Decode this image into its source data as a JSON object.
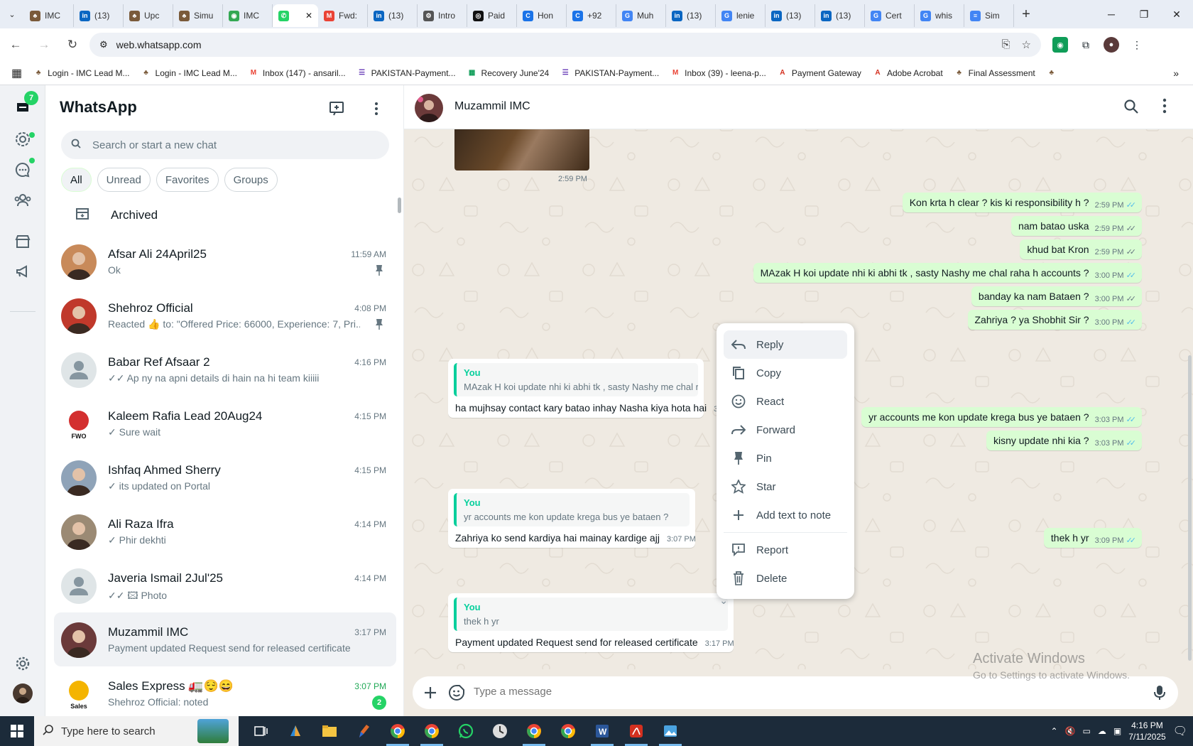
{
  "browser": {
    "tabs": [
      {
        "label": "IMC",
        "icon": "imc-icon",
        "color": "#7a5a3a"
      },
      {
        "label": "(13)",
        "icon": "linkedin-icon",
        "color": "#0a66c2"
      },
      {
        "label": "Upc",
        "icon": "imc-icon",
        "color": "#7a5a3a"
      },
      {
        "label": "Simu",
        "icon": "imc-icon",
        "color": "#7a5a3a"
      },
      {
        "label": "IMC",
        "icon": "maps-icon",
        "color": "#34a853"
      },
      {
        "label": "",
        "icon": "whatsapp-icon",
        "color": "#25d366",
        "active": true
      },
      {
        "label": "Fwd:",
        "icon": "gmail-icon",
        "color": "#ea4335"
      },
      {
        "label": "(13)",
        "icon": "linkedin-icon",
        "color": "#0a66c2"
      },
      {
        "label": "Intro",
        "icon": "gear-icon",
        "color": "#555555"
      },
      {
        "label": "Paid",
        "icon": "openai-icon",
        "color": "#111111"
      },
      {
        "label": "Hon",
        "icon": "copilot-icon",
        "color": "#1a73e8"
      },
      {
        "label": "+92",
        "icon": "copilot-icon",
        "color": "#1a73e8"
      },
      {
        "label": "Muh",
        "icon": "google-icon",
        "color": "#4285f4"
      },
      {
        "label": "(13)",
        "icon": "linkedin-icon",
        "color": "#0a66c2"
      },
      {
        "label": "lenie",
        "icon": "google-icon",
        "color": "#4285f4"
      },
      {
        "label": "(13)",
        "icon": "linkedin-icon",
        "color": "#0a66c2"
      },
      {
        "label": "(13)",
        "icon": "linkedin-icon",
        "color": "#0a66c2"
      },
      {
        "label": "Cert",
        "icon": "google-icon",
        "color": "#4285f4"
      },
      {
        "label": "whis",
        "icon": "google-icon",
        "color": "#4285f4"
      },
      {
        "label": "Sim",
        "icon": "docs-icon",
        "color": "#4285f4"
      }
    ],
    "url": "web.whatsapp.com",
    "bookmarks": [
      {
        "label": "Login - IMC Lead M...",
        "icon": "imc-icon",
        "color": "#7a5a3a"
      },
      {
        "label": "Login - IMC Lead M...",
        "icon": "imc-icon",
        "color": "#7a5a3a"
      },
      {
        "label": "Inbox (147) - ansaril...",
        "icon": "gmail-icon",
        "color": "#ea4335"
      },
      {
        "label": "PAKISTAN-Payment...",
        "icon": "forms-icon",
        "color": "#673ab7"
      },
      {
        "label": "Recovery June'24",
        "icon": "sheets-icon",
        "color": "#0f9d58"
      },
      {
        "label": "PAKISTAN-Payment...",
        "icon": "forms-icon",
        "color": "#673ab7"
      },
      {
        "label": "Inbox (39) - leena-p...",
        "icon": "gmail-icon",
        "color": "#ea4335"
      },
      {
        "label": "Payment Gateway",
        "icon": "acrobat-icon",
        "color": "#d4301f"
      },
      {
        "label": "Adobe Acrobat",
        "icon": "acrobat-icon",
        "color": "#d4301f"
      },
      {
        "label": "Final Assessment",
        "icon": "imc-icon",
        "color": "#7a5a3a"
      },
      {
        "label": "",
        "icon": "imc-icon",
        "color": "#7a5a3a"
      }
    ]
  },
  "rail": {
    "chats_badge": "7"
  },
  "sidebar": {
    "title": "WhatsApp",
    "search_placeholder": "Search or start a new chat",
    "filters": [
      "All",
      "Unread",
      "Favorites",
      "Groups"
    ],
    "archived_label": "Archived",
    "chats": [
      {
        "name": "Afsar Ali 24April25",
        "time": "11:59 AM",
        "message": "Ok",
        "pinned": true,
        "avatar": "photo",
        "avatar_color": "#c88a5a"
      },
      {
        "name": "Shehroz Official",
        "time": "4:08 PM",
        "message": "Reacted 👍 to: \"Offered Price: 66000, Experience: 7, Pri...",
        "pinned": true,
        "avatar": "photo",
        "avatar_color": "#c0392b"
      },
      {
        "name": "Babar Ref Afsaar 2",
        "time": "4:16 PM",
        "message": "✓✓ Ap ny na apni details di hain na hi team kiiiii",
        "avatar": "default"
      },
      {
        "name": "Kaleem Rafia Lead 20Aug24",
        "time": "4:15 PM",
        "message": "✓ Sure wait",
        "avatar": "logo",
        "avatar_color": "#d32f2f",
        "avatar_text": "FWO"
      },
      {
        "name": "Ishfaq Ahmed Sherry",
        "time": "4:15 PM",
        "message": "✓ its updated on Portal",
        "avatar": "photo",
        "avatar_color": "#8fa3b8"
      },
      {
        "name": "Ali Raza Ifra",
        "time": "4:14 PM",
        "message": "✓ Phir dekhti",
        "avatar": "photo",
        "avatar_color": "#9b8a74"
      },
      {
        "name": "Javeria Ismail 2Jul'25",
        "time": "4:14 PM",
        "message": "✓✓ 🖾 Photo",
        "avatar": "default"
      },
      {
        "name": "Muzammil IMC",
        "time": "3:17 PM",
        "message": "Payment updated Request send for released certificate",
        "avatar": "photo",
        "avatar_color": "#6b3a3a",
        "selected": true
      },
      {
        "name": "Sales Express 🚛😌😄",
        "time": "3:07 PM",
        "message": "Shehroz Official: noted",
        "avatar": "logo",
        "avatar_color": "#f4b400",
        "avatar_text": "Sales",
        "unread": "2"
      }
    ]
  },
  "conversation": {
    "contact_name": "Muzammil IMC",
    "image_time": "2:59 PM",
    "outgoing": [
      {
        "text": "Kon krta h clear ? kis ki responsibility h ?",
        "time": "2:59 PM",
        "read": true
      },
      {
        "text": "nam batao uska",
        "time": "2:59 PM",
        "read": false
      },
      {
        "text": "khud bat Kron",
        "time": "2:59 PM",
        "read": false
      },
      {
        "text": "MAzak H koi update nhi ki abhi tk , sasty Nashy me chal raha h accounts ?",
        "time": "3:00 PM",
        "read": true
      },
      {
        "text": "banday ka nam Bataen ?",
        "time": "3:00 PM",
        "read": false
      },
      {
        "text": "Zahriya ? ya Shobhit Sir ?",
        "time": "3:00 PM",
        "read": true
      },
      {
        "text": "yr accounts me kon update krega bus ye bataen ?",
        "time": "3:03 PM",
        "read": true
      },
      {
        "text": "kisny update nhi kia ?",
        "time": "3:03 PM",
        "read": true
      },
      {
        "text": "thek h yr",
        "time": "3:09 PM",
        "read": true
      }
    ],
    "incoming": [
      {
        "quote_author": "You",
        "quote_text": "MAzak H koi update nhi ki abhi tk , sasty Nashy me chal raha h accounts ?",
        "text": "ha mujhsay contact kary batao inhay Nasha kiya hota hai",
        "time": "3:05 PM"
      },
      {
        "quote_author": "You",
        "quote_text": "yr accounts me kon update krega bus ye bataen ?",
        "text": "Zahriya ko send kardiya hai mainay kardige ajj",
        "time": "3:07 PM"
      },
      {
        "quote_author": "You",
        "quote_text": "thek h yr",
        "text": "Payment updated Request send for released certificate",
        "time": "3:17 PM"
      }
    ],
    "context_menu": [
      {
        "label": "Reply",
        "icon": "reply-icon"
      },
      {
        "label": "Copy",
        "icon": "copy-icon"
      },
      {
        "label": "React",
        "icon": "emoji-icon"
      },
      {
        "label": "Forward",
        "icon": "forward-icon"
      },
      {
        "label": "Pin",
        "icon": "pin-icon"
      },
      {
        "label": "Star",
        "icon": "star-icon"
      },
      {
        "label": "Add text to note",
        "icon": "plus-icon"
      },
      {
        "label": "Report",
        "icon": "report-icon"
      },
      {
        "label": "Delete",
        "icon": "delete-icon"
      }
    ],
    "composer_placeholder": "Type a message"
  },
  "watermark": {
    "line1": "Activate Windows",
    "line2": "Go to Settings to activate Windows."
  },
  "taskbar": {
    "search_placeholder": "Type here to search",
    "time": "4:16 PM",
    "date": "7/11/2025"
  },
  "colors": {
    "accent": "#25d366",
    "bubble_out": "#d9fdd3",
    "read_tick": "#53bdeb"
  }
}
